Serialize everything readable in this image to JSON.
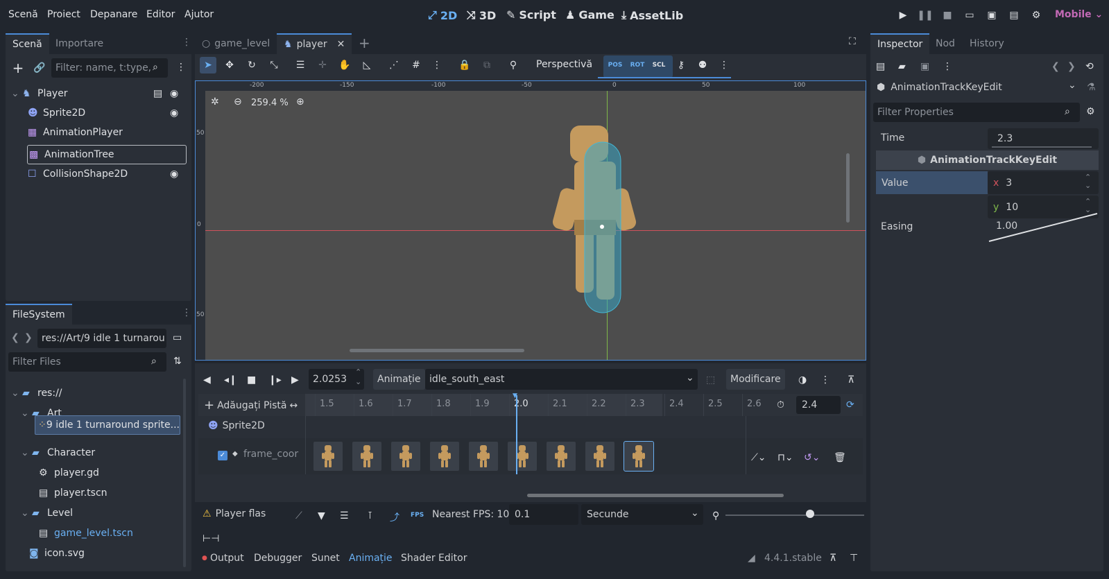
{
  "menu": [
    "Scenă",
    "Proiect",
    "Depanare",
    "Editor",
    "Ajutor"
  ],
  "workspaces": [
    {
      "label": "2D",
      "icon": "2d-icon",
      "active": true
    },
    {
      "label": "3D",
      "icon": "3d-icon"
    },
    {
      "label": "Script",
      "icon": "script-icon"
    },
    {
      "label": "Game",
      "icon": "game-icon"
    },
    {
      "label": "AssetLib",
      "icon": "assetlib-icon"
    }
  ],
  "renderer": "Mobile",
  "scene_panel": {
    "tabs": [
      "Scenă",
      "Importare"
    ],
    "filter_placeholder": "Filter: name, t:type,",
    "nodes": [
      {
        "name": "Player",
        "icon": "player-node-icon"
      },
      {
        "name": "Sprite2D",
        "icon": "sprite2d-icon"
      },
      {
        "name": "AnimationPlayer",
        "icon": "animation-player-icon"
      },
      {
        "name": "AnimationTree",
        "icon": "animation-tree-icon"
      },
      {
        "name": "CollisionShape2D",
        "icon": "collision-shape-icon"
      }
    ]
  },
  "filesystem": {
    "title": "FileSystem",
    "path": "res://Art/9 idle 1 turnarou",
    "filter_placeholder": "Filter Files",
    "items": [
      {
        "label": "res://",
        "type": "folder"
      },
      {
        "label": "Art",
        "type": "folder"
      },
      {
        "label": "9 idle 1 turnaround sprite...",
        "type": "file"
      },
      {
        "label": "Character",
        "type": "folder"
      },
      {
        "label": "player.gd",
        "type": "script"
      },
      {
        "label": "player.tscn",
        "type": "scene"
      },
      {
        "label": "Level",
        "type": "folder"
      },
      {
        "label": "game_level.tscn",
        "type": "scene"
      },
      {
        "label": "icon.svg",
        "type": "image"
      }
    ]
  },
  "editor_tabs": [
    "game_level",
    "player"
  ],
  "viewport": {
    "perspective_label": "Perspectivă",
    "zoom": "259.4 %",
    "ruler_h": [
      "-200",
      "-150",
      "-100",
      "-50",
      "0",
      "50",
      "100"
    ],
    "ruler_v": [
      "50",
      "0",
      "50"
    ]
  },
  "animation": {
    "time": "2.0253",
    "animatie_label": "Animație",
    "current": "idle_south_east",
    "modify_label": "Modificare",
    "add_track_label": "Adăugați Pistă",
    "ticks": [
      "1.5",
      "1.6",
      "1.7",
      "1.8",
      "1.9",
      "2.0",
      "2.1",
      "2.2",
      "2.3",
      "2.4",
      "2.5",
      "2.6"
    ],
    "length": "2.4",
    "track_node": "Sprite2D",
    "track_property": "frame_coor",
    "frame_count": 9,
    "warning": "Player flas",
    "fps_label": "Nearest FPS: 10",
    "snap": "0.1",
    "unit": "Secunde"
  },
  "bottom_tabs": [
    "Output",
    "Debugger",
    "Sunet",
    "Animație",
    "Shader Editor"
  ],
  "version": "4.4.1.stable",
  "inspector": {
    "tabs": [
      "Inspector",
      "Nod",
      "History"
    ],
    "object": "AnimationTrackKeyEdit",
    "filter_placeholder": "Filter Properties",
    "time_label": "Time",
    "time_value": "2.3",
    "section": "AnimationTrackKeyEdit",
    "value_label": "Value",
    "x_label": "x",
    "x_value": "3",
    "y_label": "y",
    "y_value": "10",
    "easing_label": "Easing",
    "easing_value": "1.00"
  },
  "colors": {
    "accent": "#4b8bd8",
    "bg": "#21262e",
    "panel": "#2a2f37",
    "mobile": "#c269b5"
  }
}
